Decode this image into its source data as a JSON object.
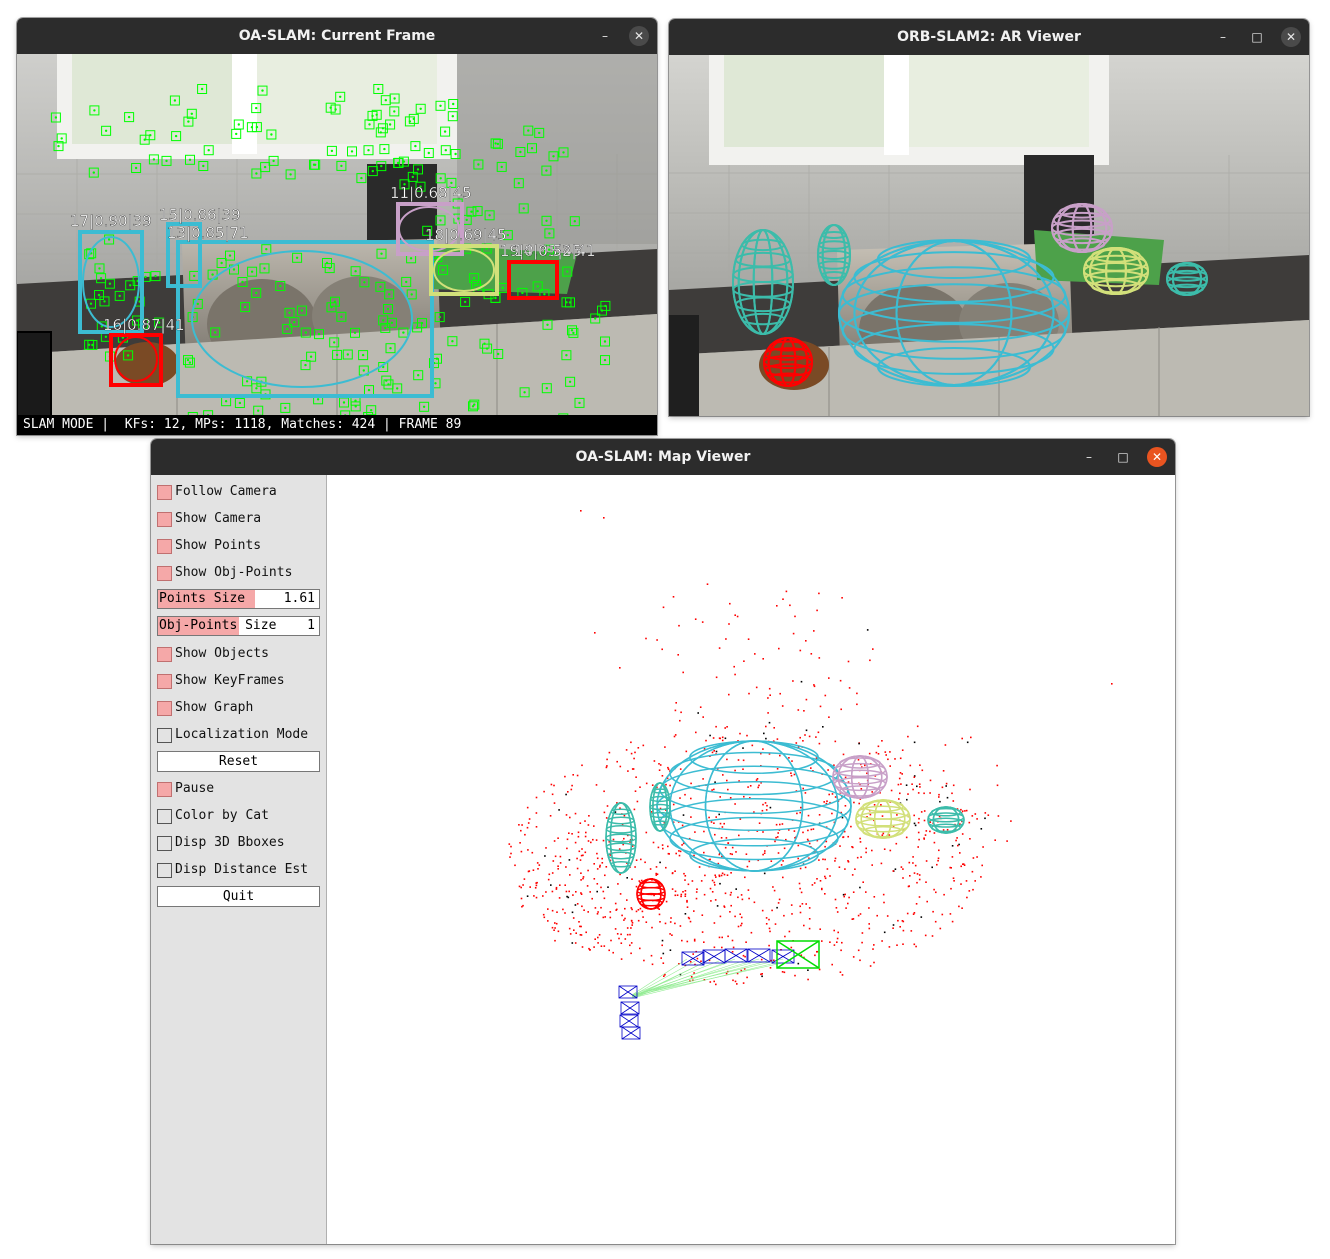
{
  "current_frame_window": {
    "title": "OA-SLAM: Current Frame",
    "minimize": "–",
    "close": "✕",
    "detections": [
      {
        "label": "17|0.90|39"
      },
      {
        "label": "15|0.86|39"
      },
      {
        "label": "13|0.85|71"
      },
      {
        "label": "11|0.68|45"
      },
      {
        "label": "18|0.69|45"
      },
      {
        "label": "19|0.63|45"
      },
      {
        "label": "14|0.52|41"
      },
      {
        "label": "16|0.87|41"
      }
    ],
    "status_text": "SLAM MODE |  KFs: 12, MPs: 1118, Matches: 424 | FRAME 89"
  },
  "ar_viewer_window": {
    "title": "ORB-SLAM2: AR Viewer",
    "minimize": "–",
    "maximize": "□",
    "close": "✕"
  },
  "map_viewer_window": {
    "title": "OA-SLAM: Map Viewer",
    "minimize": "–",
    "maximize": "□",
    "close": "✕",
    "panel": {
      "follow_camera": {
        "label": "Follow Camera",
        "checked": true
      },
      "show_camera": {
        "label": "Show Camera",
        "checked": true
      },
      "show_points": {
        "label": "Show Points",
        "checked": true
      },
      "show_obj_points": {
        "label": "Show Obj-Points",
        "checked": true
      },
      "points_size": {
        "label": "Points Size",
        "value": "1.61",
        "fill_fraction": 0.6
      },
      "obj_points_size": {
        "label": "Obj-Points Size",
        "value": "1",
        "fill_fraction": 0.5
      },
      "show_objects": {
        "label": "Show Objects",
        "checked": true
      },
      "show_keyframes": {
        "label": "Show KeyFrames",
        "checked": true
      },
      "show_graph": {
        "label": "Show Graph",
        "checked": true
      },
      "localization_mode": {
        "label": "Localization Mode",
        "checked": false
      },
      "reset": {
        "label": "Reset"
      },
      "pause": {
        "label": "Pause",
        "checked": true
      },
      "color_by_cat": {
        "label": "Color by Cat",
        "checked": false
      },
      "disp_3d_bboxes": {
        "label": "Disp 3D Bboxes",
        "checked": false
      },
      "disp_distance_est": {
        "label": "Disp Distance Est",
        "checked": false
      },
      "quit": {
        "label": "Quit"
      }
    }
  },
  "colors": {
    "cyan": "#3cbcd2",
    "teal": "#3cbcaa",
    "pink": "#c8a0c8",
    "yellowgreen": "#d2e07a",
    "red": "#ff0000",
    "feature_green": "#00ff00",
    "keyframe_blue": "#0000c8"
  }
}
